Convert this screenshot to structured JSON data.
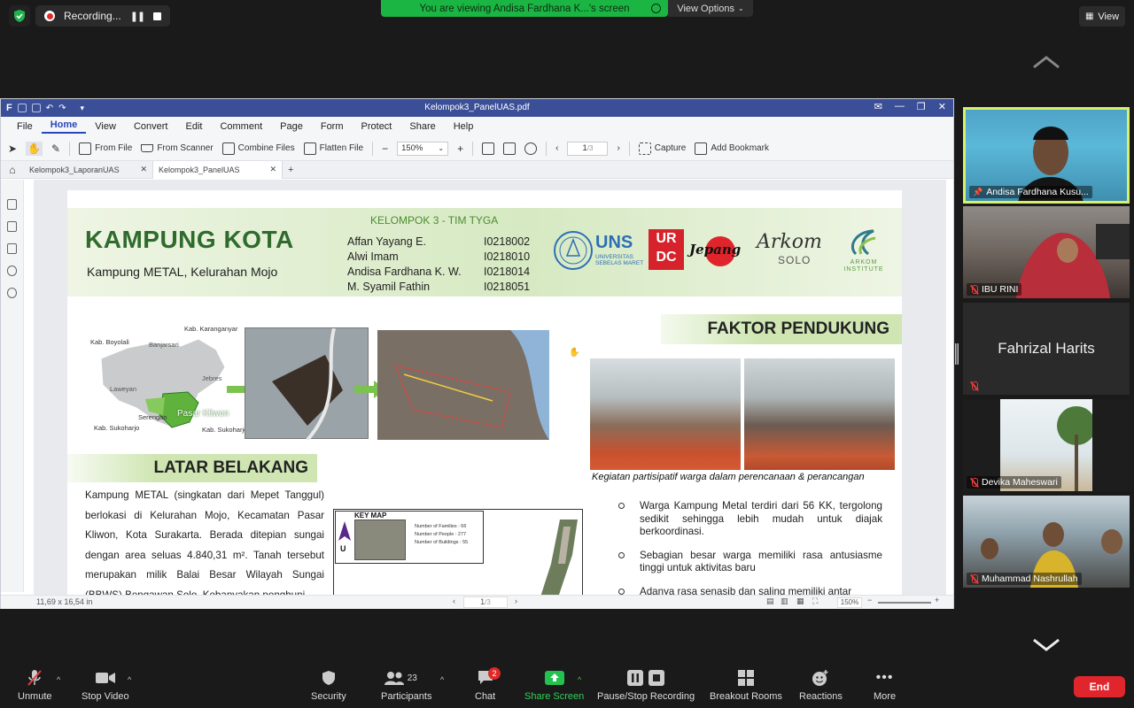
{
  "zoom_top": {
    "recording_label": "Recording...",
    "viewing_banner": "You are viewing Andisa Fardhana K...'s screen",
    "view_options": "View Options",
    "view_button": "View"
  },
  "pdf_app": {
    "window_title": "Kelompok3_PanelUAS.pdf",
    "menu": [
      "File",
      "Home",
      "View",
      "Convert",
      "Edit",
      "Comment",
      "Page",
      "Form",
      "Protect",
      "Share",
      "Help"
    ],
    "active_menu": "Home",
    "toolbar": {
      "from_file": "From File",
      "from_scanner": "From Scanner",
      "combine_files": "Combine Files",
      "flatten_file": "Flatten File",
      "zoom_level": "150%",
      "page_current": "1",
      "page_total": "/3",
      "capture": "Capture",
      "add_bookmark": "Add Bookmark"
    },
    "tabs": [
      {
        "label": "Kelompok3_LaporanUAS",
        "active": false
      },
      {
        "label": "Kelompok3_PanelUAS",
        "active": true
      }
    ],
    "status": {
      "page_size": "11,69 x 16,54 in",
      "page_current": "1",
      "page_total": "/3",
      "zoom": "150%"
    }
  },
  "document": {
    "title": "KAMPUNG KOTA",
    "subtitle": "Kampung METAL, Kelurahan Mojo",
    "group": "KELOMPOK 3 - TIM TYGA",
    "members": [
      {
        "name": "Affan Yayang E.",
        "nim": "I0218002"
      },
      {
        "name": "Alwi Imam",
        "nim": "I0218010"
      },
      {
        "name": "Andisa Fardhana K. W.",
        "nim": "I0218014"
      },
      {
        "name": "M. Syamil Fathin",
        "nim": "I0218051"
      }
    ],
    "logos": {
      "uns": "UNS",
      "uns_sub1": "UNIVERSITAS",
      "uns_sub2": "SEBELAS MARET",
      "urdc_top": "UR",
      "urdc_bottom": "DC",
      "jepang": "Jepang",
      "arkom": "Arkom",
      "arkom_solo": "SOLO",
      "arkom_inst1": "ARKOM",
      "arkom_inst2": "INSTITUTE"
    },
    "map_labels": {
      "karanganyar": "Kab. Karanganyar",
      "boyolali": "Kab. Boyolali",
      "banjarsari": "Banjarsari",
      "jebres": "Jebres",
      "laweyan": "Laweyan",
      "serengan": "Serengan",
      "pasar_kliwon": "Pasar Kliwon",
      "sukoharjo_left": "Kab. Sukoharjo",
      "sukoharjo_right": "Kab. Sukoharjo"
    },
    "faktor_heading": "FAKTOR PENDUKUNG",
    "photo_caption": "Kegiatan partisipatif warga dalam perencanaan & perancangan",
    "latar_heading": "LATAR BELAKANG",
    "latar_text": "Kampung METAL (singkatan dari Mepet Tanggul) berlokasi di Kelurahan Mojo, Kecamatan Pasar Kliwon, Kota Surakarta. Berada ditepian sungai dengan area seluas 4.840,31 m². Tanah tersebut merupakan milik Balai Besar Wilayah Sungai (BBWS) Bengawan Solo. Kebanyakan penghuni",
    "key_map": {
      "title": "KEY MAP",
      "north": "U",
      "stats": [
        "Number of Families : 66",
        "Number of People : 277",
        "Number of Buildings : 55"
      ]
    },
    "bullets": [
      "Warga Kampung Metal terdiri dari 56 KK, tergolong sedikit sehingga lebih mudah untuk diajak berkoordinasi.",
      "Sebagian besar warga memiliki rasa antusiasme tinggi untuk aktivitas baru",
      "Adanya rasa senasib dan saling memiliki antar"
    ]
  },
  "participants": [
    {
      "name": "Andisa Fardhana Kusu...",
      "pinned": true
    },
    {
      "name": "IBU RINI",
      "muted": true
    },
    {
      "name": "Fahrizal Harits",
      "muted": true
    },
    {
      "name": "Devika Maheswari",
      "muted": true
    },
    {
      "name": "Muhammad Nashrullah",
      "muted": true
    }
  ],
  "bottom_bar": {
    "unmute": "Unmute",
    "stop_video": "Stop Video",
    "security": "Security",
    "participants": "Participants",
    "participants_count": "23",
    "chat": "Chat",
    "chat_badge": "2",
    "share_screen": "Share Screen",
    "pause_recording": "Pause/Stop Recording",
    "breakout_rooms": "Breakout Rooms",
    "reactions": "Reactions",
    "more": "More",
    "end": "End"
  },
  "colors": {
    "pdf_titlebar": "#3b4e98",
    "viewing_banner": "#1bb544",
    "end_button": "#e0262c",
    "active_speaker": "#d7f06b",
    "heading_green": "#2f6b2c"
  }
}
